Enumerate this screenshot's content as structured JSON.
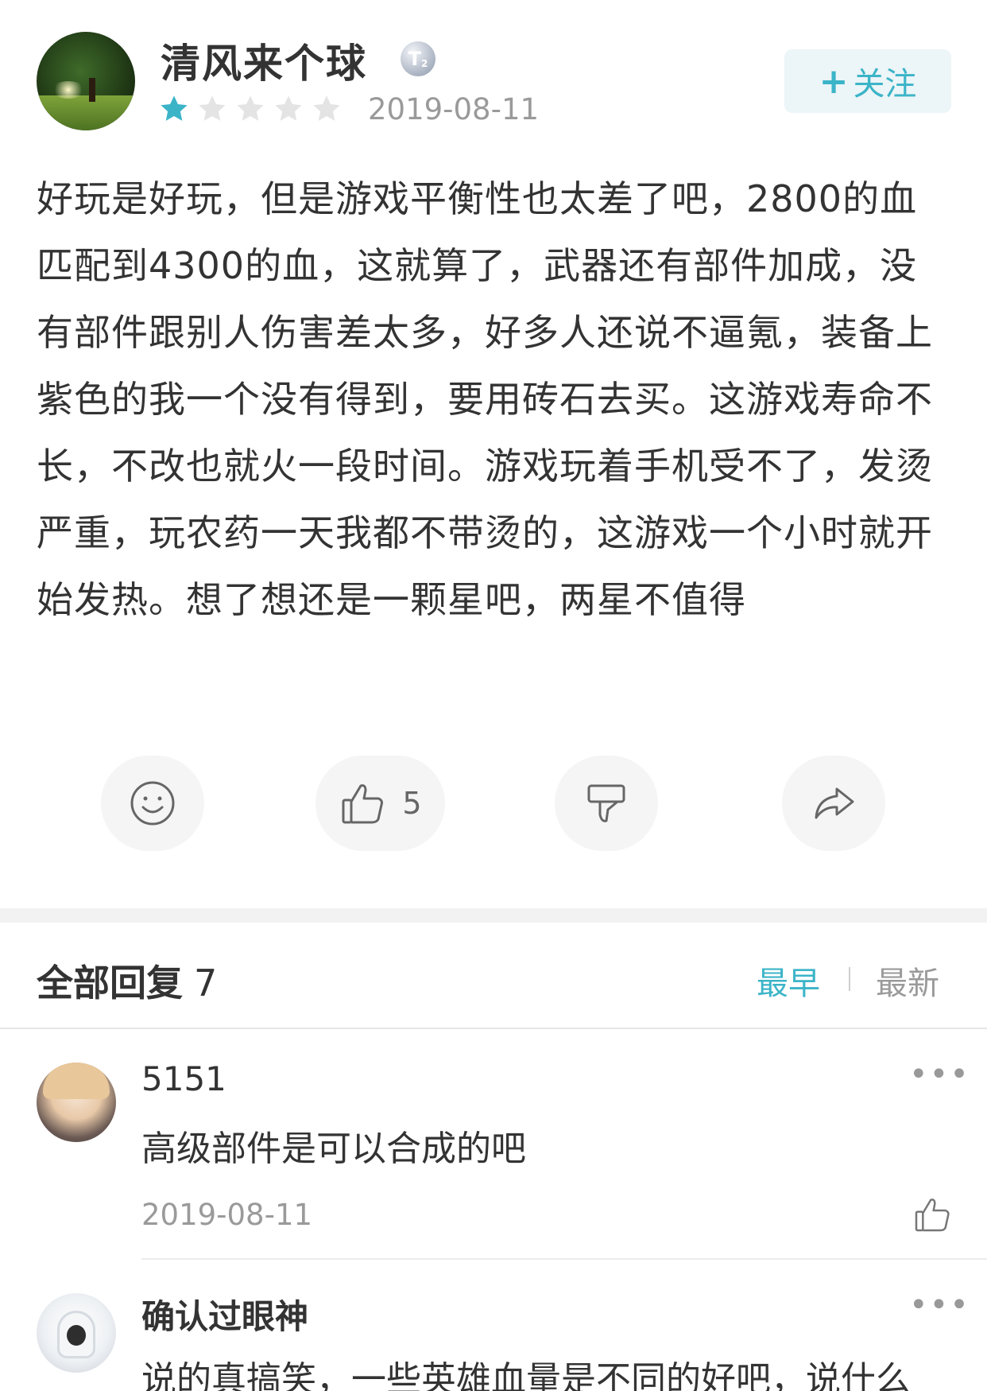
{
  "review": {
    "username": "清风来个球",
    "badge": {
      "letter": "T",
      "level": "2"
    },
    "rating": 1,
    "max_rating": 5,
    "date": "2019-08-11",
    "follow": {
      "plus": "+",
      "label": "关注"
    },
    "body": "好玩是好玩，但是游戏平衡性也太差了吧，2800的血匹配到4300的血，这就算了，武器还有部件加成，没有部件跟别人伤害差太多，好多人还说不逼氪，装备上紫色的我一个没有得到，要用砖石去买。这游戏寿命不长，不改也就火一段时间。游戏玩着手机受不了，发烫严重，玩农药一天我都不带烫的，这游戏一个小时就开始发热。想了想还是一颗星吧，两星不值得",
    "actions": {
      "like_count": "5"
    }
  },
  "replies_section": {
    "title": "全部回复",
    "count": "7",
    "sort_earliest": "最早",
    "sort_latest": "最新"
  },
  "replies": [
    {
      "name": "5151",
      "text": "高级部件是可以合成的吧",
      "date": "2019-08-11",
      "more": "•••"
    },
    {
      "name": "确认过眼神",
      "text": "说的真搞笑，一些英雄血量是不同的好吧，说什么",
      "more": "•••"
    }
  ],
  "colors": {
    "accent": "#3cb4c8",
    "star_on": "#3cb4c8",
    "star_off": "#e4e4e4"
  },
  "icons": {
    "review_actions": [
      "smile-icon",
      "thumbs-up-icon",
      "thumbs-down-icon",
      "share-icon"
    ],
    "reply_like": "thumbs-up-icon"
  }
}
